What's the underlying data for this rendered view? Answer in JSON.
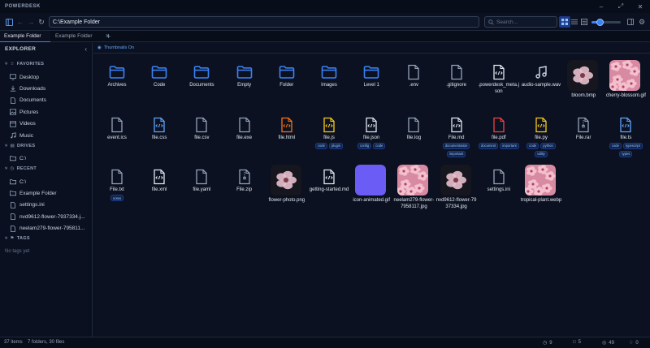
{
  "app": {
    "name": "POWERDESK"
  },
  "toolbar": {
    "path": "C:\\Example Folder",
    "search_placeholder": "Search...",
    "zoom_fraction": 0.3
  },
  "tabs": [
    {
      "label": "Example Folder",
      "active": true
    },
    {
      "label": "Example Folder",
      "active": false
    }
  ],
  "sidebar": {
    "title": "EXPLORER",
    "favorites_label": "FAVORITES",
    "favorites": [
      {
        "label": "Desktop",
        "icon": "desktop-icon"
      },
      {
        "label": "Downloads",
        "icon": "download-icon"
      },
      {
        "label": "Documents",
        "icon": "document-icon"
      },
      {
        "label": "Pictures",
        "icon": "image-icon"
      },
      {
        "label": "Videos",
        "icon": "video-icon"
      },
      {
        "label": "Music",
        "icon": "music-icon"
      }
    ],
    "drives_label": "DRIVES",
    "drives": [
      {
        "label": "C:\\",
        "icon": "folder-icon"
      }
    ],
    "recent_label": "RECENT",
    "recent": [
      {
        "label": "C:\\",
        "icon": "folder-icon"
      },
      {
        "label": "Example Folder",
        "icon": "folder-icon"
      },
      {
        "label": "settings.ini",
        "icon": "file-icon"
      },
      {
        "label": "nvd9612-flower-7937334.j...",
        "icon": "file-icon"
      },
      {
        "label": "neelam279-flower-795811...",
        "icon": "file-icon"
      }
    ],
    "tags_label": "TAGS",
    "no_tags": "No tags yet"
  },
  "main": {
    "thumbnails_label": "Thumbnails On"
  },
  "files": [
    {
      "name": "Archives",
      "kind": "folder"
    },
    {
      "name": "Code",
      "kind": "folder"
    },
    {
      "name": "Documents",
      "kind": "folder"
    },
    {
      "name": "Empty",
      "kind": "folder"
    },
    {
      "name": "Folder",
      "kind": "folder"
    },
    {
      "name": "Images",
      "kind": "folder"
    },
    {
      "name": "Level 1",
      "kind": "folder"
    },
    {
      "name": ".env",
      "kind": "file"
    },
    {
      "name": ".gitignore",
      "kind": "file"
    },
    {
      "name": ".powerdesk_meta.json",
      "kind": "code",
      "color": "#e2e8f0"
    },
    {
      "name": "audio-sample.wav",
      "kind": "music"
    },
    {
      "name": "bloom.bmp",
      "kind": "image",
      "palette": "dark"
    },
    {
      "name": "cherry-blossom.gif",
      "kind": "image",
      "palette": "pink"
    },
    {
      "name": "event.ics",
      "kind": "file"
    },
    {
      "name": "file.css",
      "kind": "code",
      "color": "#60a5fa"
    },
    {
      "name": "file.csv",
      "kind": "file"
    },
    {
      "name": "file.exe",
      "kind": "file"
    },
    {
      "name": "file.html",
      "kind": "code",
      "color": "#f97316"
    },
    {
      "name": "file.js",
      "kind": "code",
      "color": "#facc15",
      "tags": [
        "code",
        "plugin"
      ]
    },
    {
      "name": "file.json",
      "kind": "code",
      "color": "#e2e8f0",
      "tags": [
        "config",
        "code"
      ]
    },
    {
      "name": "file.log",
      "kind": "file"
    },
    {
      "name": "File.md",
      "kind": "code",
      "color": "#e2e8f0",
      "tags": [
        "documentation",
        "important"
      ]
    },
    {
      "name": "file.pdf",
      "kind": "file",
      "color": "#ef4444",
      "tags": [
        "document",
        "important"
      ]
    },
    {
      "name": "file.py",
      "kind": "code",
      "color": "#facc15",
      "tags": [
        "code",
        "python",
        "utility"
      ]
    },
    {
      "name": "File.rar",
      "kind": "archive"
    },
    {
      "name": "file.ts",
      "kind": "code",
      "color": "#60a5fa",
      "tags": [
        "code",
        "typescript",
        "types"
      ]
    },
    {
      "name": "File.txt",
      "kind": "file",
      "tags": [
        "notes"
      ]
    },
    {
      "name": "file.xml",
      "kind": "code",
      "color": "#e2e8f0"
    },
    {
      "name": "file.yaml",
      "kind": "file"
    },
    {
      "name": "File.zip",
      "kind": "archive"
    },
    {
      "name": "flower-photo.png",
      "kind": "image",
      "palette": "dark"
    },
    {
      "name": "getting-started.md",
      "kind": "code",
      "color": "#e2e8f0"
    },
    {
      "name": "icon-animated.gif",
      "kind": "image",
      "palette": "violet"
    },
    {
      "name": "neelam279-flower-7958117.jpg",
      "kind": "image",
      "palette": "pink"
    },
    {
      "name": "nvd9612-flower-7937334.jpg",
      "kind": "image",
      "palette": "dark"
    },
    {
      "name": "settings.ini",
      "kind": "file"
    },
    {
      "name": "tropical-plant.webp",
      "kind": "image",
      "palette": "pink"
    }
  ],
  "status": {
    "items": "37 items",
    "summary": "7 folders, 30 files",
    "c1": "9",
    "c2": "5",
    "c3": "49",
    "c4": "0"
  }
}
